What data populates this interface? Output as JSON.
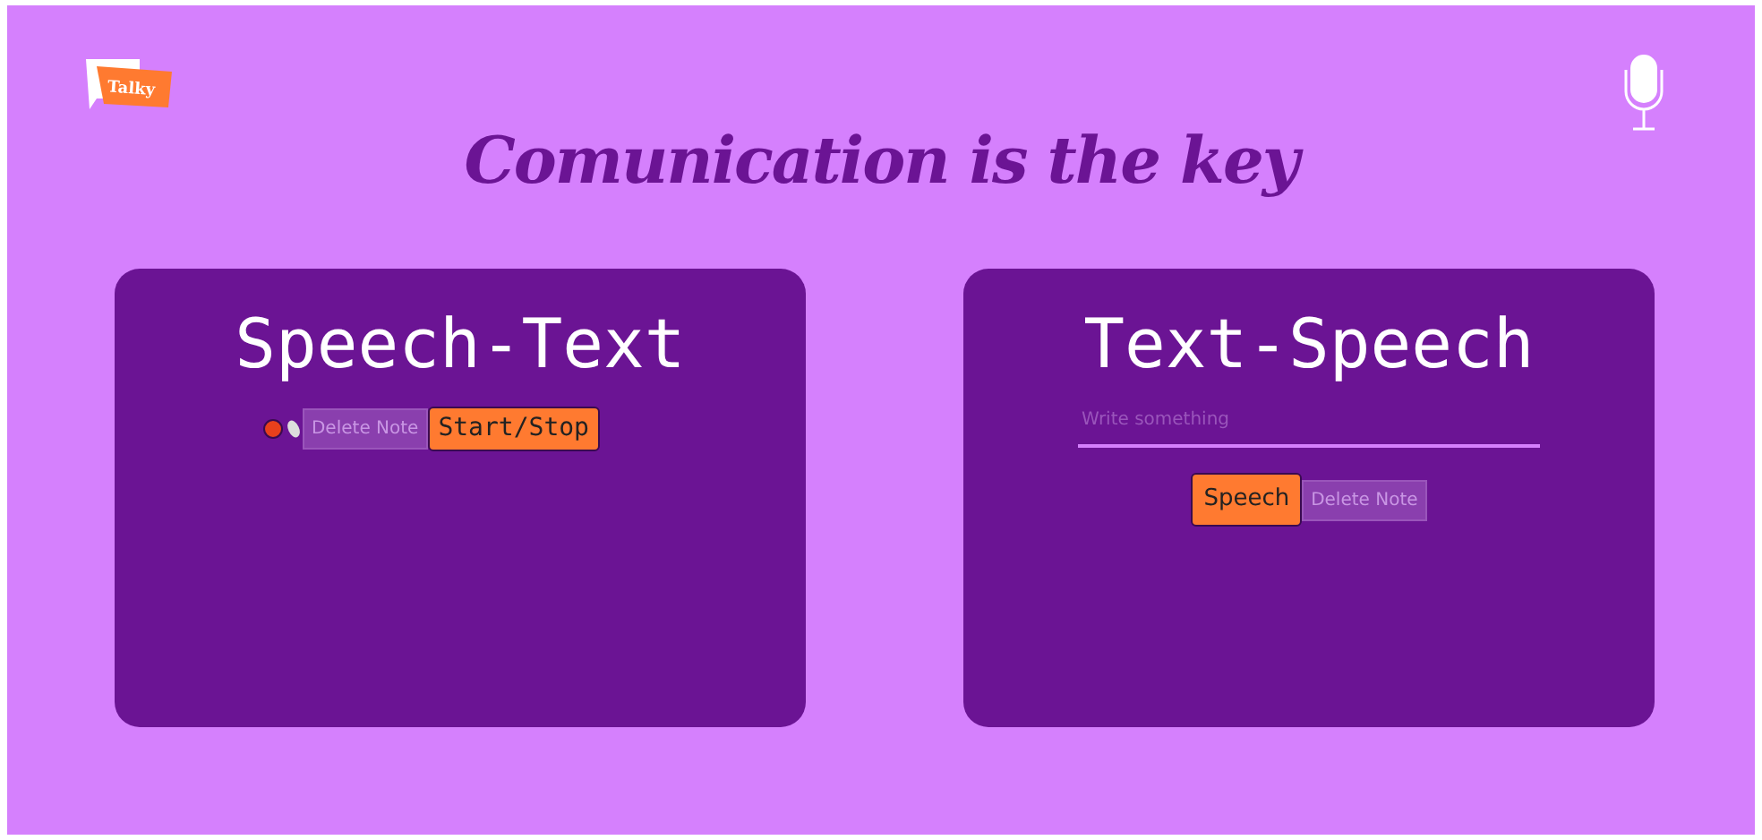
{
  "logo": {
    "text": "Talky"
  },
  "title": "Comunication is the key",
  "panels": [
    {
      "heading": "Speech-Text",
      "kind": "recorder",
      "buttons": [
        {
          "label": "Delete Note",
          "disabled": true
        },
        {
          "label": "Start/Stop",
          "disabled": false
        }
      ]
    },
    {
      "heading": "Text-Speech",
      "kind": "speaker",
      "placeholder": "Write something",
      "buttons": [
        {
          "label": "Speech",
          "disabled": false
        },
        {
          "label": "Delete Note",
          "disabled": true
        }
      ]
    }
  ]
}
